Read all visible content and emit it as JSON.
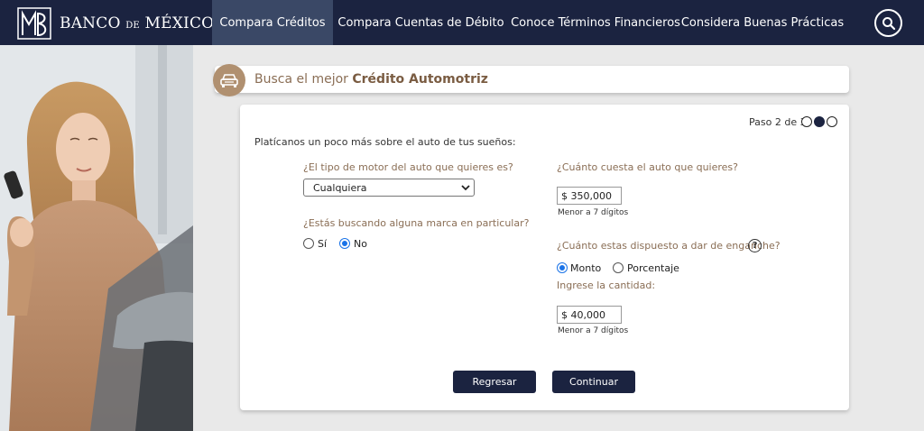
{
  "header": {
    "logo_main": "BANCO",
    "logo_de": "DE",
    "logo_country": "MÉXICO",
    "logo_reg": "®",
    "nav": [
      {
        "label": "Compara Créditos"
      },
      {
        "label": "Compara Cuentas de Débito"
      },
      {
        "label": "Conoce Términos Financieros"
      },
      {
        "label": "Considera Buenas Prácticas"
      }
    ],
    "search_icon": "search-icon"
  },
  "title": {
    "prefix": "Busca el mejor",
    "bold": "Crédito Automotriz",
    "icon": "car-icon"
  },
  "form": {
    "step_label": "Paso 2 de 3",
    "step_current": 2,
    "step_total": 3,
    "intro": "Platícanos un poco más sobre el auto de tus sueños:",
    "motor_question": "¿El tipo de motor del auto que quieres es?",
    "motor_value": "Cualquiera",
    "brand_question": "¿Estás buscando alguna marca en particular?",
    "brand_yes": "Sí",
    "brand_no": "No",
    "brand_selected": "No",
    "cost_question": "¿Cuánto cuesta el auto que quieres?",
    "cost_value": "$ 350,000",
    "cost_hint": "Menor a 7 dígitos",
    "down_question": "¿Cuánto estas dispuesto a dar de enganche?",
    "help_symbol": "?",
    "down_opt_amount": "Monto",
    "down_opt_percent": "Porcentaje",
    "down_selected": "Monto",
    "amount_label": "Ingrese la cantidad:",
    "amount_value": "$ 40,000",
    "amount_hint": "Menor a 7 dígitos"
  },
  "buttons": {
    "back": "Regresar",
    "continue": "Continuar"
  },
  "colors": {
    "navy": "#1b2340",
    "nav_active": "#3a4866",
    "accent_brown": "#8a6e55",
    "radio_blue": "#1a73e8"
  }
}
